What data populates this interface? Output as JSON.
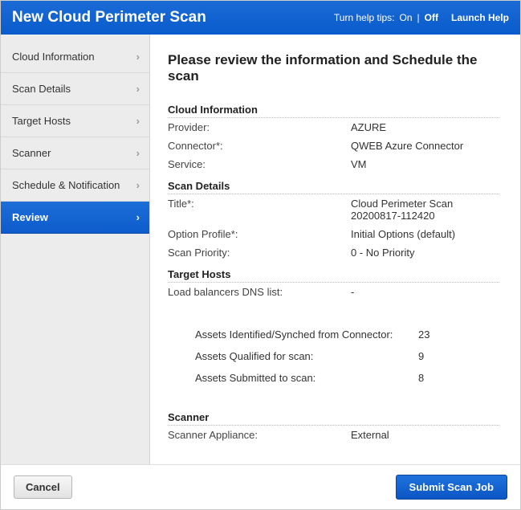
{
  "header": {
    "title": "New Cloud Perimeter Scan",
    "help_label": "Turn help tips:",
    "help_on": "On",
    "help_sep": "|",
    "help_off": "Off",
    "launch_help": "Launch Help"
  },
  "sidebar": {
    "items": [
      {
        "label": "Cloud Information"
      },
      {
        "label": "Scan Details"
      },
      {
        "label": "Target Hosts"
      },
      {
        "label": "Scanner"
      },
      {
        "label": "Schedule & Notification"
      },
      {
        "label": "Review"
      }
    ]
  },
  "main": {
    "title": "Please review the information and Schedule the scan",
    "sections": {
      "cloud_info": {
        "heading": "Cloud Information",
        "provider_label": "Provider:",
        "provider_value": "AZURE",
        "connector_label": "Connector*:",
        "connector_value": "QWEB Azure Connector",
        "service_label": "Service:",
        "service_value": "VM"
      },
      "scan_details": {
        "heading": "Scan Details",
        "title_label": "Title*:",
        "title_value": "Cloud Perimeter Scan 20200817-112420",
        "profile_label": "Option Profile*:",
        "profile_value": "Initial Options (default)",
        "priority_label": "Scan Priority:",
        "priority_value": "0 - No Priority"
      },
      "target_hosts": {
        "heading": "Target Hosts",
        "lb_label": "Load balancers DNS list:",
        "lb_value": "-",
        "stats": {
          "identified_label": "Assets Identified/Synched from Connector:",
          "identified_value": "23",
          "qualified_label": "Assets Qualified for scan:",
          "qualified_value": "9",
          "submitted_label": "Assets Submitted to scan:",
          "submitted_value": "8"
        }
      },
      "scanner": {
        "heading": "Scanner",
        "appliance_label": "Scanner Appliance:",
        "appliance_value": "External"
      }
    }
  },
  "footer": {
    "cancel": "Cancel",
    "submit": "Submit Scan Job"
  }
}
